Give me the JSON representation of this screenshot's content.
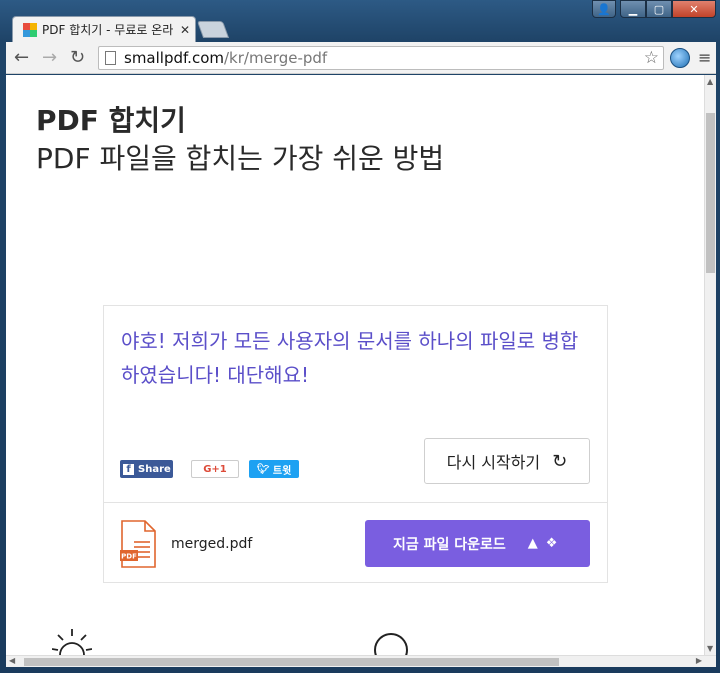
{
  "browser": {
    "tab_title": "PDF 합치기 - 무료로 온라",
    "tab_close": "✕",
    "url_host": "smallpdf.com",
    "url_path": "/kr/merge-pdf"
  },
  "page": {
    "title": "PDF 합치기",
    "subtitle": "PDF 파일을 합치는 가장 쉬운 방법"
  },
  "result": {
    "message": "야호! 저희가 모든 사용자의 문서를 하나의 파일로 병합하였습니다! 대단해요!",
    "share": {
      "facebook": "Share",
      "gplus": "G+1",
      "twitter": "트윗"
    },
    "restart_label": "다시 시작하기",
    "file_name": "merged.pdf",
    "file_badge": "PDF",
    "download_label": "지금 파일 다운로드"
  },
  "colors": {
    "accent": "#7a5ee0",
    "message_text": "#5b4fc9"
  }
}
